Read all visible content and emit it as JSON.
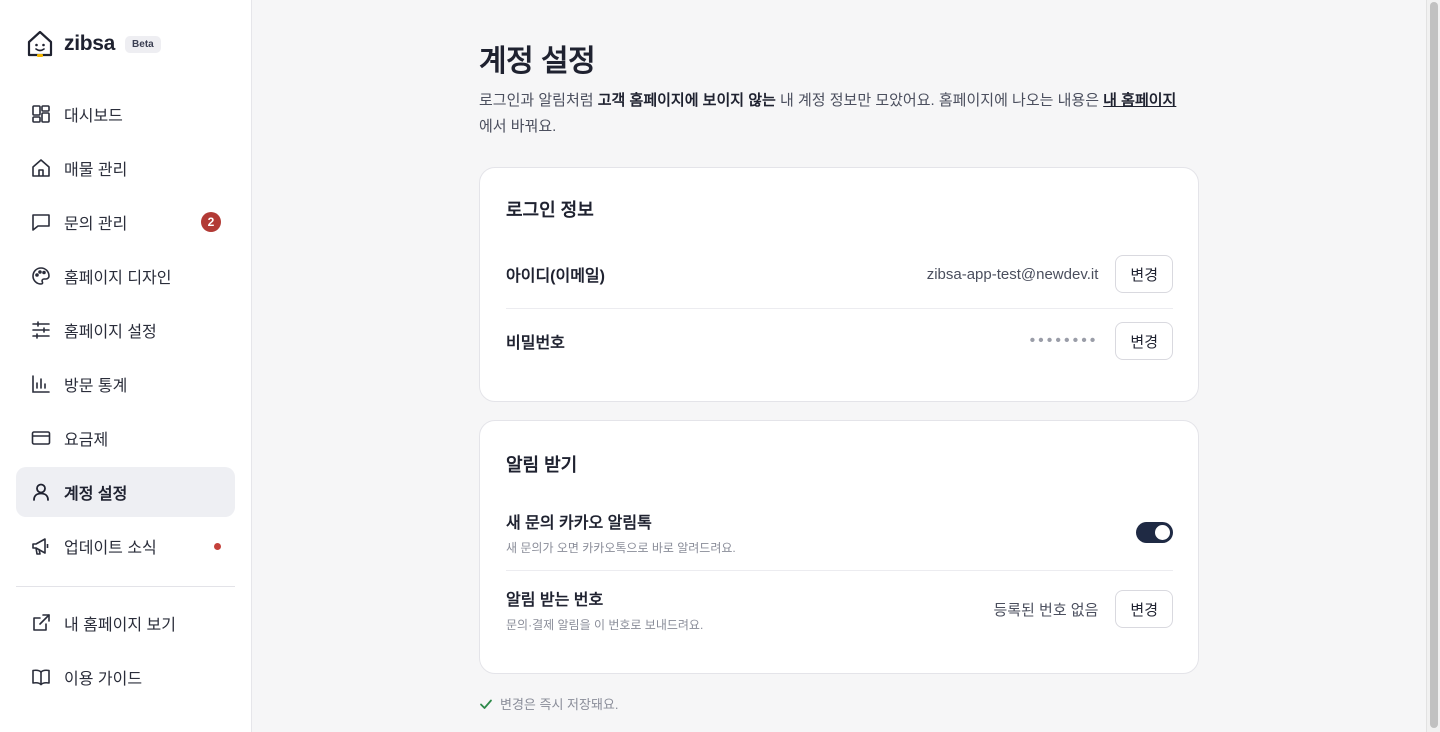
{
  "brand": {
    "name": "zibsa",
    "badge": "Beta"
  },
  "sidebar": {
    "items": [
      {
        "label": "대시보드",
        "icon": "dashboard-icon"
      },
      {
        "label": "매물 관리",
        "icon": "home-icon"
      },
      {
        "label": "문의 관리",
        "icon": "chat-icon",
        "badge": "2"
      },
      {
        "label": "홈페이지 디자인",
        "icon": "palette-icon"
      },
      {
        "label": "홈페이지 설정",
        "icon": "sliders-icon"
      },
      {
        "label": "방문 통계",
        "icon": "bar-chart-icon"
      },
      {
        "label": "요금제",
        "icon": "credit-card-icon"
      },
      {
        "label": "계정 설정",
        "icon": "user-icon",
        "active": true
      },
      {
        "label": "업데이트 소식",
        "icon": "megaphone-icon",
        "dot": true
      }
    ],
    "bottom_items": [
      {
        "label": "내 홈페이지 보기",
        "icon": "external-link-icon"
      },
      {
        "label": "이용 가이드",
        "icon": "book-icon"
      }
    ]
  },
  "main": {
    "title": "계정 설정",
    "intro": {
      "part1": "로그인과 알림처럼 ",
      "bold": "고객 홈페이지에 보이지 않는",
      "part2": " 내 계정 정보만 모았어요. 홈페이지에 나오는 내용은 ",
      "link": "내 홈페이지",
      "part3": "에서 바꿔요."
    },
    "login_card": {
      "title": "로그인 정보",
      "id_label": "아이디(이메일)",
      "id_value": "zibsa-app-test@newdev.it",
      "password_label": "비밀번호",
      "password_value": "••••••••",
      "change_label": "변경"
    },
    "notify_card": {
      "title": "알림 받기",
      "kakao_label": "새 문의 카카오 알림톡",
      "kakao_sub": "새 문의가 오면 카카오톡으로 바로 알려드려요.",
      "kakao_enabled": true,
      "phone_label": "알림 받는 번호",
      "phone_sub": "문의·결제 알림을 이 번호로 보내드려요.",
      "phone_value": "등록된 번호 없음",
      "change_label": "변경"
    },
    "saved_note": "변경은 즉시 저장돼요."
  },
  "colors": {
    "accent": "#1f2a44",
    "badge": "#b23a35",
    "background": "#f6f6f7"
  }
}
